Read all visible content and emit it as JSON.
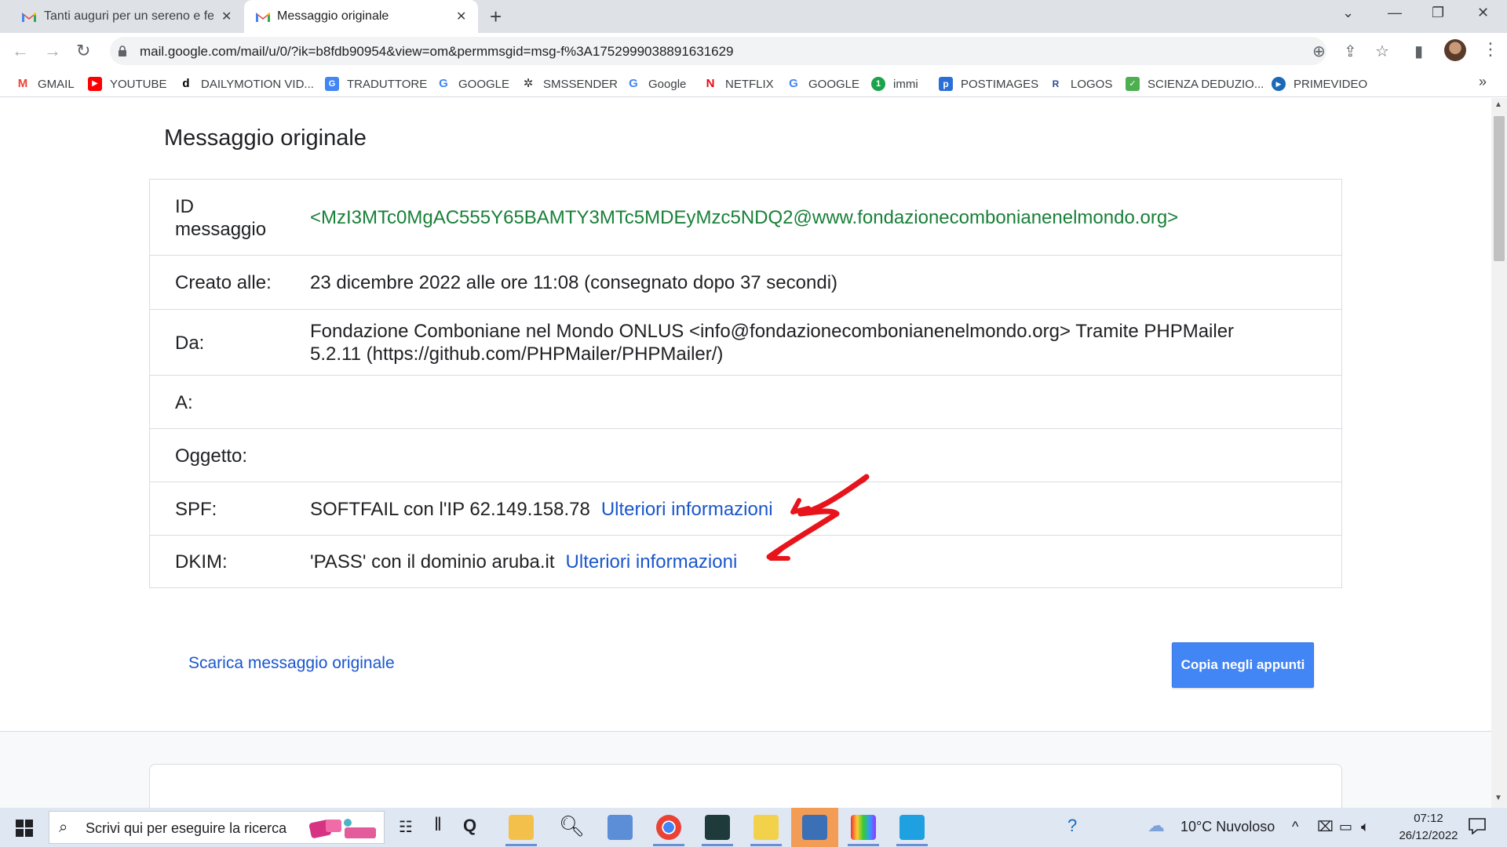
{
  "browser": {
    "tabs": [
      {
        "title": "Tanti auguri per un sereno e felice",
        "icon": "gmail-icon"
      },
      {
        "title": "Messaggio originale",
        "icon": "gmail-icon",
        "active": true
      }
    ],
    "url": "mail.google.com/mail/u/0/?ik=b8fdb90954&view=om&permmsgid=msg-f%3A1752999038891631629",
    "bookmarks": [
      {
        "label": "GMAIL",
        "icon": "gmail-icon"
      },
      {
        "label": "YOUTUBE",
        "icon": "youtube-icon"
      },
      {
        "label": "DAILYMOTION VID...",
        "icon": "dailymotion-icon"
      },
      {
        "label": "TRADUTTORE",
        "icon": "translate-icon"
      },
      {
        "label": "GOOGLE",
        "icon": "google-icon"
      },
      {
        "label": "SMSSENDER",
        "icon": "smssender-icon"
      },
      {
        "label": "Google",
        "icon": "google-icon"
      },
      {
        "label": "NETFLIX",
        "icon": "netflix-icon"
      },
      {
        "label": "GOOGLE",
        "icon": "google-icon"
      },
      {
        "label": "immi",
        "icon": "immi-icon"
      },
      {
        "label": "POSTIMAGES",
        "icon": "postimages-icon"
      },
      {
        "label": "LOGOS",
        "icon": "logos-icon"
      },
      {
        "label": "SCIENZA DEDUZIO...",
        "icon": "bookmark-icon"
      },
      {
        "label": "PRIMEVIDEO",
        "icon": "primevideo-icon"
      }
    ]
  },
  "main": {
    "title": "Messaggio originale",
    "rows": {
      "id": {
        "label_line1": "ID",
        "label_line2": "messaggio",
        "value": "<MzI3MTc0MgAC555Y65BAMTY3MTc5MDEyMzc5NDQ2@www.fondazionecombonianenelmondo.org>"
      },
      "created": {
        "label": "Creato alle:",
        "value": "23 dicembre 2022 alle ore 11:08 (consegnato dopo 37 secondi)"
      },
      "from": {
        "label": "Da:",
        "value_line1": "Fondazione Comboniane nel Mondo ONLUS <info@fondazionecombonianenelmondo.org> Tramite PHPMailer",
        "value_line2": "5.2.11 (https://github.com/PHPMailer/PHPMailer/)"
      },
      "to": {
        "label": "A:",
        "value": ""
      },
      "subject": {
        "label": "Oggetto:",
        "value": ""
      },
      "spf": {
        "label": "SPF:",
        "value": "SOFTFAIL con l'IP 62.149.158.78",
        "link": "Ulteriori informazioni"
      },
      "dkim": {
        "label": "DKIM:",
        "value": "'PASS' con il dominio aruba.it",
        "link": "Ulteriori informazioni"
      }
    },
    "download_link": "Scarica messaggio originale",
    "copy_button": "Copia negli appunti"
  },
  "taskbar": {
    "search_placeholder": "Scrivi qui per eseguire la ricerca",
    "weather": "10°C  Nuvoloso",
    "time": "07:12",
    "date": "26/12/2022"
  },
  "colors": {
    "link": "#1a56cc",
    "message_id": "#188038",
    "primary_button": "#4285f4",
    "annotation_arrow": "#e8141b"
  }
}
